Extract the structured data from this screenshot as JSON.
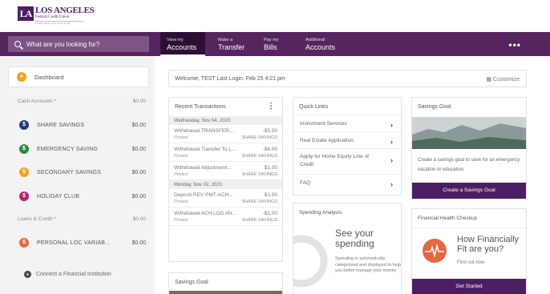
{
  "brand": {
    "logo_mark": "LA",
    "line1": "LOS ANGELES",
    "line2": "Federal Credit Union",
    "tagline": "ENRICHING YOUR FUTURE"
  },
  "search": {
    "placeholder": "What are you looking for?"
  },
  "nav": [
    {
      "small": "View my",
      "big": "Accounts"
    },
    {
      "small": "Make a",
      "big": "Transfer"
    },
    {
      "small": "Pay my",
      "big": "Bills"
    },
    {
      "small": "Additional",
      "big": "Accounts"
    }
  ],
  "more_label": "•••",
  "sidebar": {
    "dashboard_label": "Dashboard",
    "cash_label": "Cash Accounts ^",
    "cash_total": "$0.00",
    "cash_accounts": [
      {
        "name": "SHARE SAVINGS",
        "balance": "$0.00",
        "color": "#1f3b7a"
      },
      {
        "name": "EMERGENCY SAVING",
        "balance": "$0.00",
        "color": "#2e8a3a"
      },
      {
        "name": "SECONDARY SAVINGS",
        "balance": "$0.00",
        "color": "#f2a024"
      },
      {
        "name": "HOLIDAY CLUB",
        "balance": "$0.00",
        "color": "#b3246a"
      }
    ],
    "loans_label": "Loans & Credit ^",
    "loans_total": "$0.00",
    "loan_accounts": [
      {
        "name": "PERSONAL LOC VARIAB...",
        "balance": "$0.00",
        "color": "#e5683e"
      }
    ],
    "connect_label": "Connect a Financial Institution"
  },
  "welcome": {
    "text": "Welcome, TEST   Last Login: Feb 25 4:21 pm",
    "customize": "Customize"
  },
  "recent": {
    "title": "Recent Transactions",
    "groups": [
      {
        "date": "Wednesday, Nov 04, 2020",
        "items": [
          {
            "desc": "Withdrawal TRANSFER...",
            "amount": "-$5.00",
            "status": "Posted",
            "account": "SHARE SAVINGS"
          },
          {
            "desc": "Withdrawal Transfer To L...",
            "amount": "-$4.00",
            "status": "Posted",
            "account": "SHARE SAVINGS"
          },
          {
            "desc": "Withdrawal Adjustment...",
            "amount": "$1.00",
            "status": "Posted",
            "account": "SHARE SAVINGS"
          }
        ]
      },
      {
        "date": "Monday, Nov 02, 2020",
        "items": [
          {
            "desc": "Deposit REV PMT-ACH...",
            "amount": "$1.00",
            "status": "Posted",
            "account": "SHARE SAVINGS"
          },
          {
            "desc": "Withdrawal ACH LOS AN...",
            "amount": "-$1.00",
            "status": "Posted",
            "account": "SHARE SAVINGS"
          }
        ]
      }
    ]
  },
  "quick_links": {
    "title": "Quick Links",
    "items": [
      "Investment Services",
      "Real Estate Application",
      "Apply for Home Equity Line of Credit",
      "FAQ"
    ]
  },
  "savings_goal": {
    "title": "Savings Goal",
    "text": "Create a savings goal to save for an emergency vacation or education.",
    "button": "Create a Savings Goal"
  },
  "savings_goal_2": {
    "title": "Savings Goal"
  },
  "spending": {
    "title": "Spending Analysis",
    "headline": "See your spending",
    "desc": "Spending is automatically categorized and displayed to help you better manage your money"
  },
  "health": {
    "title": "Financial Health Checkup",
    "headline": "How Financially Fit are you?",
    "sub": "Find out now",
    "button": "Get Started"
  }
}
